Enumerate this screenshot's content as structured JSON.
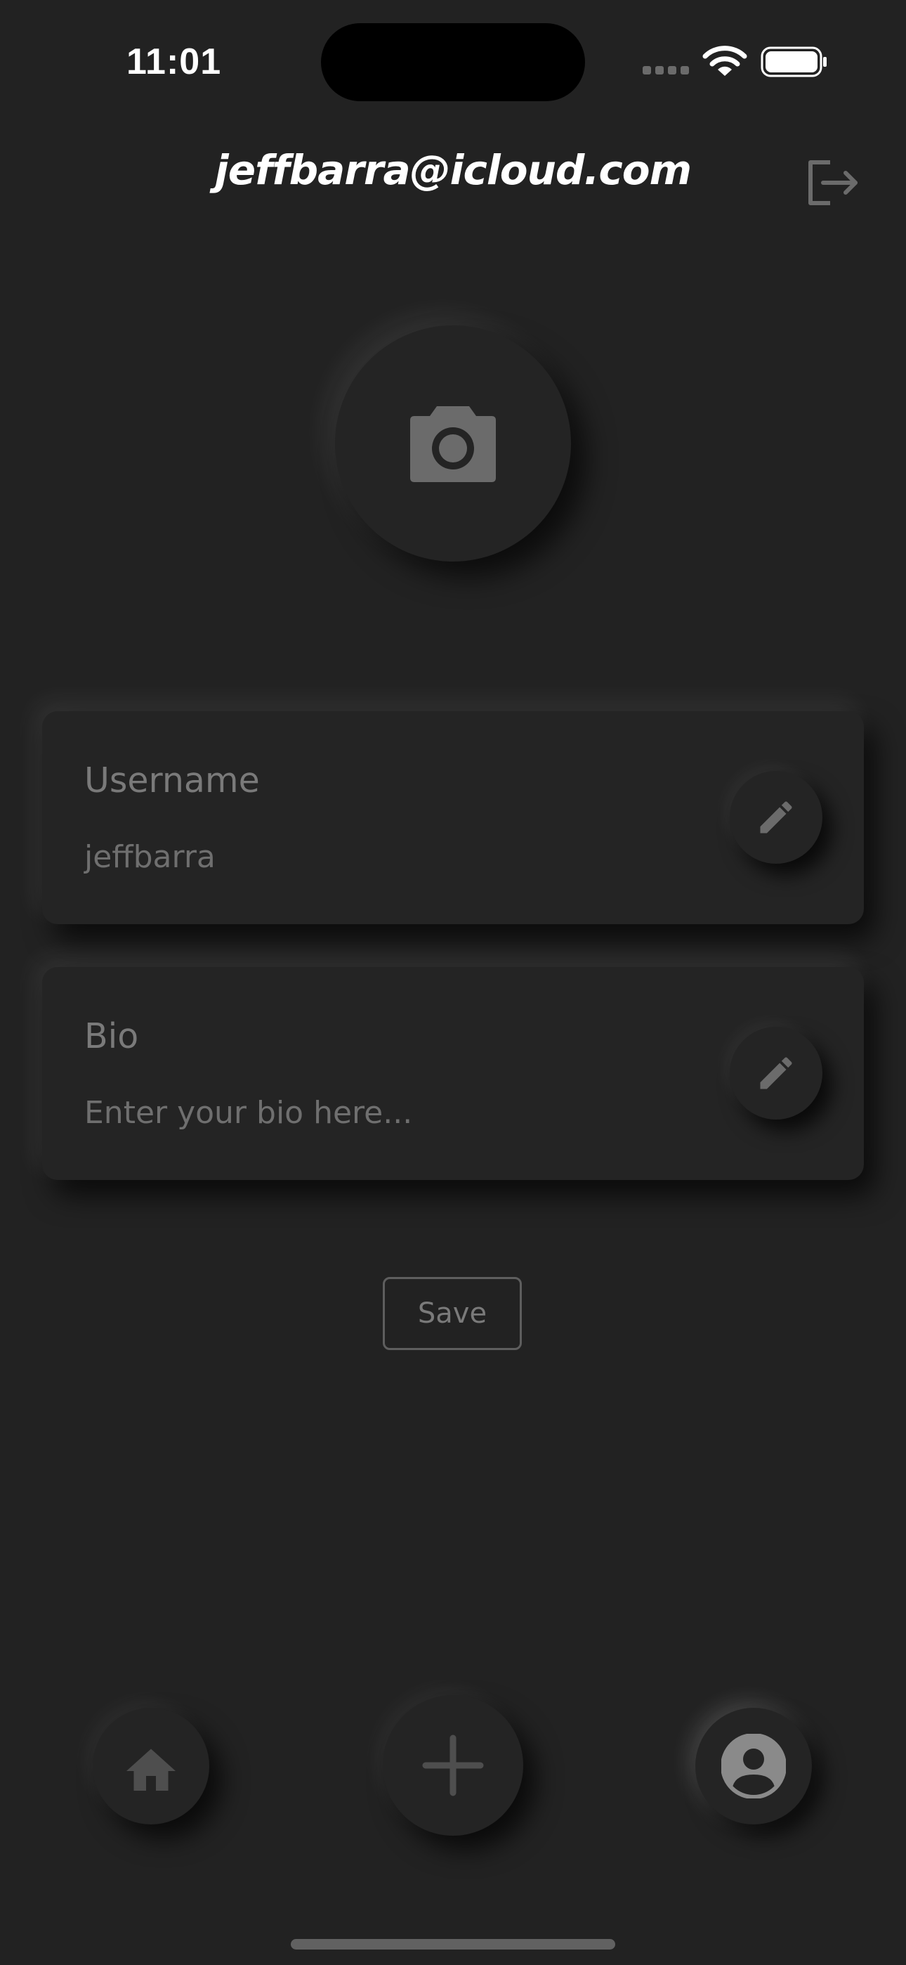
{
  "status_bar": {
    "time": "11:01",
    "icons": [
      "cellular-signal-icon",
      "wifi-icon",
      "battery-icon"
    ]
  },
  "header": {
    "title": "jeffbarra@icloud.com",
    "logout_icon": "logout-icon"
  },
  "avatar": {
    "icon": "camera-icon"
  },
  "profile_fields": {
    "username": {
      "label": "Username",
      "value": "jeffbarra",
      "edit_icon": "pencil-icon"
    },
    "bio": {
      "label": "Bio",
      "placeholder": "Enter your bio here...",
      "edit_icon": "pencil-icon"
    }
  },
  "actions": {
    "save_label": "Save"
  },
  "bottom_nav": {
    "items": [
      {
        "name": "home",
        "icon": "home-icon"
      },
      {
        "name": "add",
        "icon": "plus-icon"
      },
      {
        "name": "profile",
        "icon": "account-circle-icon",
        "active": true
      }
    ]
  },
  "colors": {
    "background": "#222222",
    "surface": "#242424",
    "label_text": "#7a7a7a",
    "muted_text": "#6f6f6f",
    "icon_gray": "#6b6b6b",
    "active_icon": "#8a8a8a",
    "title_text": "#ffffff"
  }
}
